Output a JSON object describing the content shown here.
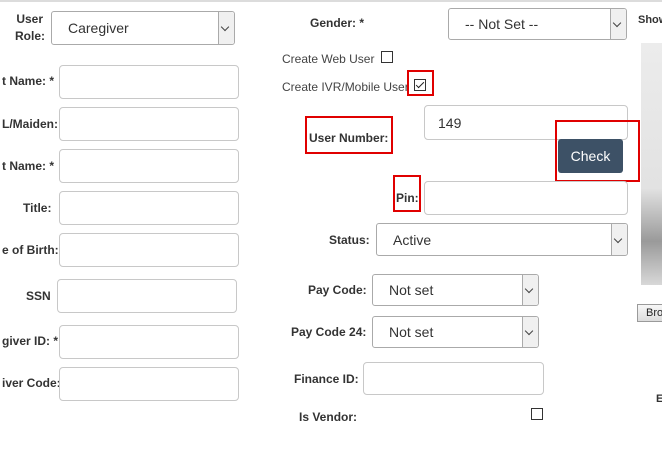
{
  "left_column": {
    "user_role": {
      "label_line1": "User",
      "label_line2": "Role:",
      "value": "Caregiver"
    },
    "first_name": {
      "label": "t Name:"
    },
    "middle_maiden": {
      "label": "L/Maiden:"
    },
    "last_name": {
      "label": "t Name:"
    },
    "title": {
      "label": "Title:"
    },
    "date_of_birth": {
      "label": "e of Birth:"
    },
    "ssn": {
      "label": "SSN"
    },
    "caregiver_id": {
      "label": "giver ID:"
    },
    "caregiver_code": {
      "label": "iver Code:"
    }
  },
  "middle_column": {
    "gender": {
      "label": "Gender:",
      "value": "-- Not Set --"
    },
    "create_web_user": {
      "label": "Create Web User",
      "checked": false
    },
    "create_ivr_user": {
      "label": "Create IVR/Mobile User",
      "checked": true
    },
    "user_number": {
      "label": "User Number:",
      "value": "149"
    },
    "check_button": {
      "label": "Check"
    },
    "pin": {
      "label": "Pin:"
    },
    "status": {
      "label": "Status:",
      "value": "Active"
    },
    "pay_code": {
      "label": "Pay Code:",
      "value": "Not set"
    },
    "pay_code_24": {
      "label": "Pay Code 24:",
      "value": "Not set"
    },
    "finance_id": {
      "label": "Finance ID:"
    },
    "is_vendor": {
      "label": "Is Vendor:",
      "checked": false
    }
  },
  "right_column": {
    "show_label": "Show",
    "browse_button": "Bro",
    "cut_letter": "E"
  },
  "colors": {
    "highlight": "#e00000",
    "button": "#3d5166"
  }
}
